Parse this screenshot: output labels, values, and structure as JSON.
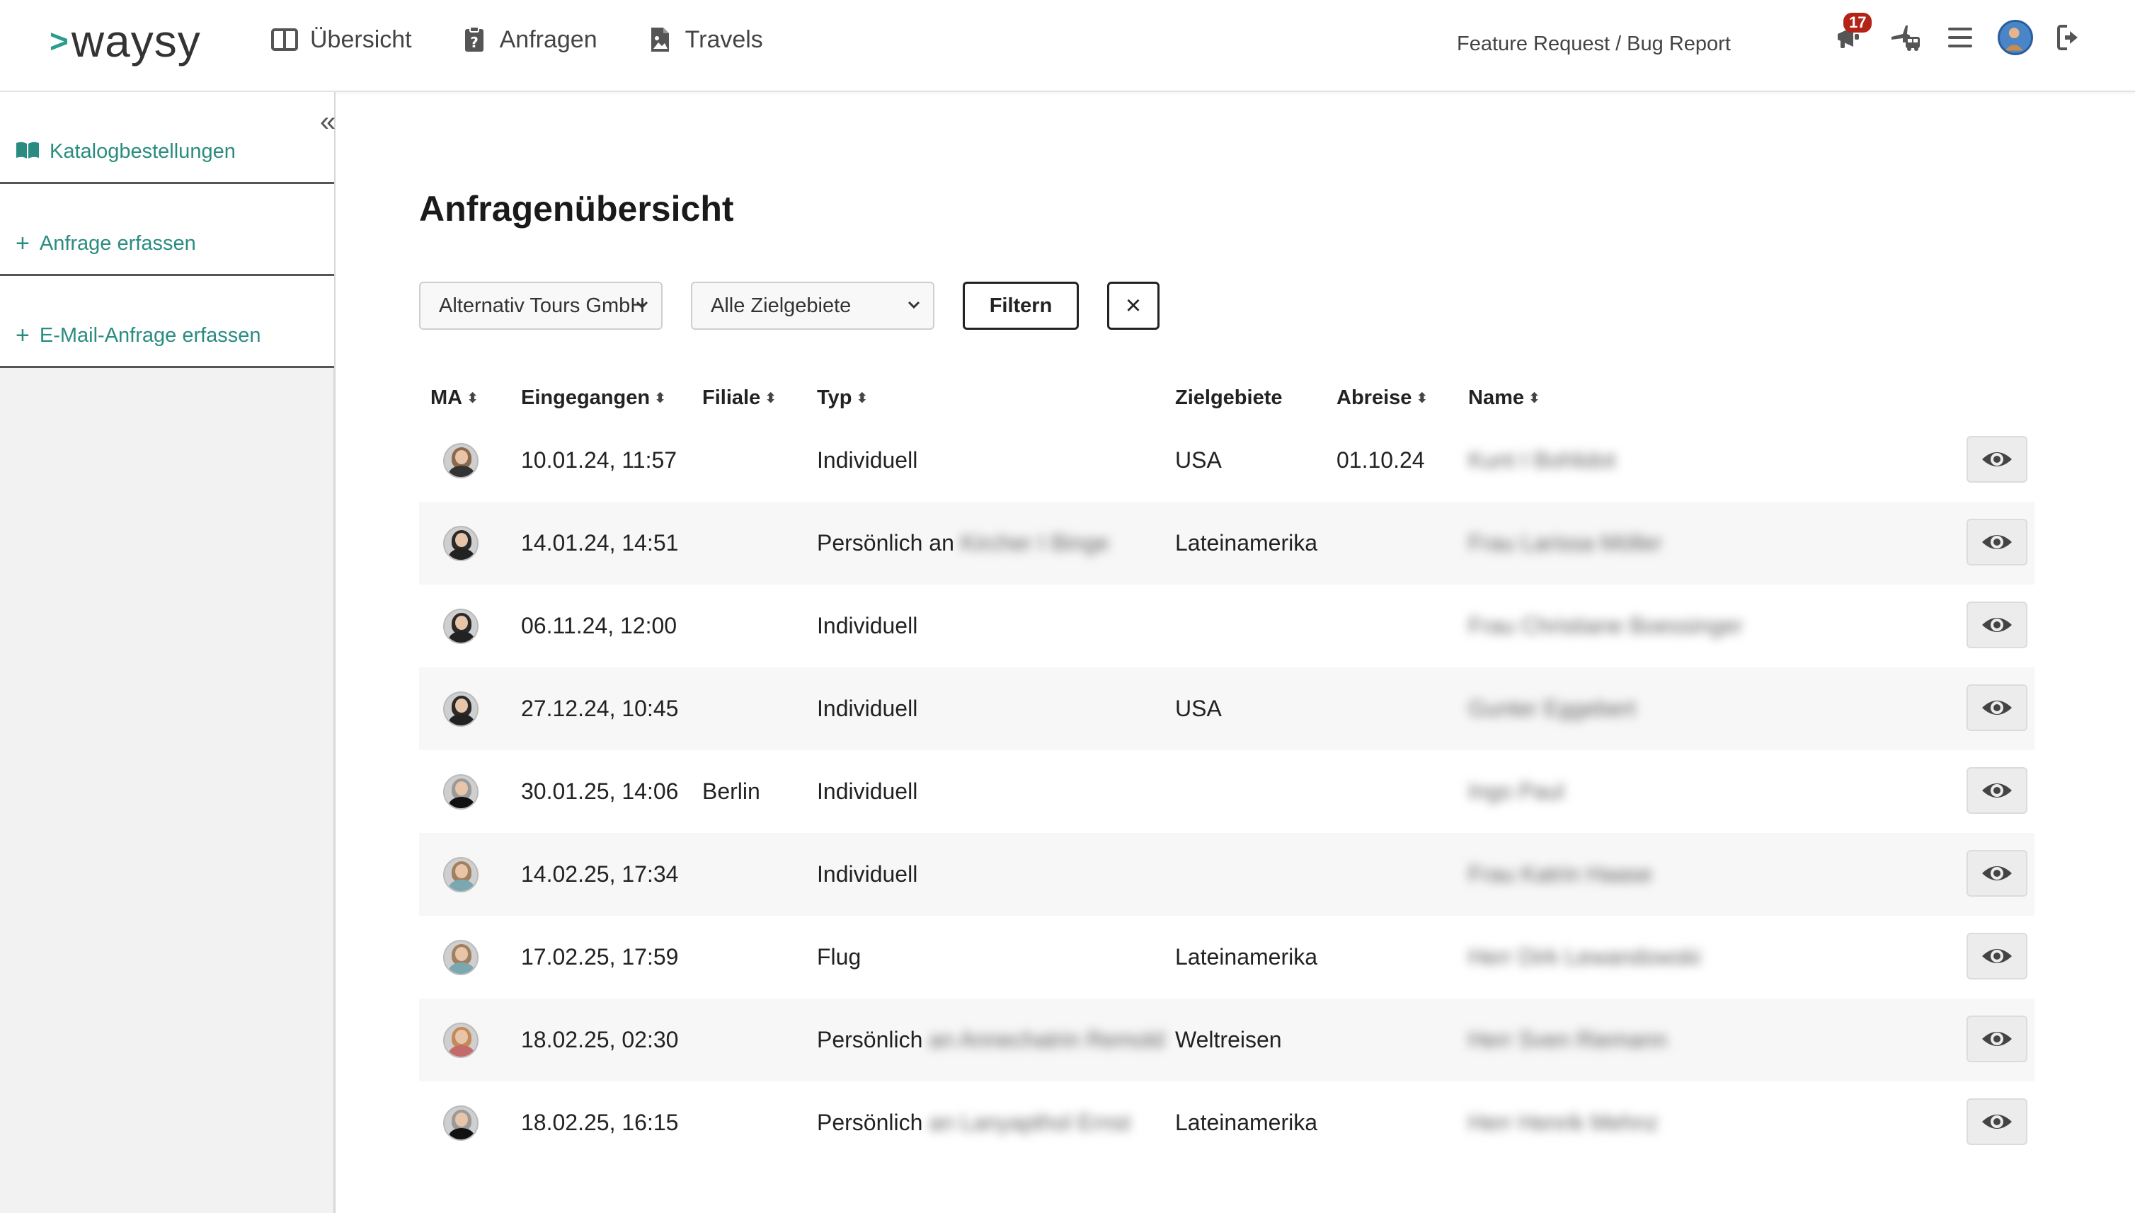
{
  "brand": {
    "name": "waysy",
    "arrow": ">"
  },
  "nav": {
    "links": [
      {
        "label": "Übersicht",
        "icon": "columns-icon"
      },
      {
        "label": "Anfragen",
        "icon": "clipboard-question-icon"
      },
      {
        "label": "Travels",
        "icon": "file-image-icon"
      }
    ],
    "feature_link": "Feature Request / Bug Report",
    "notifications_count": "17"
  },
  "sidebar": {
    "collapse": "«",
    "items": [
      {
        "label": "Katalogbestellungen",
        "icon": "book-open-icon"
      },
      {
        "label": "Anfrage erfassen",
        "icon": "plus-icon"
      },
      {
        "label": "E-Mail-Anfrage erfassen",
        "icon": "plus-icon"
      }
    ]
  },
  "page": {
    "title": "Anfragenübersicht"
  },
  "filters": {
    "company_select": "Alternativ Tours GmbH",
    "region_select": "Alle Zielgebiete",
    "filter_button": "Filtern",
    "clear_button": "×"
  },
  "table": {
    "columns": [
      "MA",
      "Eingegangen",
      "Filiale",
      "Typ",
      "Zielgebiete",
      "Abreise",
      "Name"
    ],
    "rows": [
      {
        "received": "10.01.24, 11:57",
        "branch": "",
        "type": "Individuell",
        "type_extra": "",
        "region": "USA",
        "departure": "01.10.24",
        "name": "Kunt I Bohlidot"
      },
      {
        "received": "14.01.24, 14:51",
        "branch": "",
        "type": "Persönlich an",
        "type_extra": "Kircher I Binge",
        "region": "Lateinamerika",
        "departure": "",
        "name": "Frau Larissa Möller"
      },
      {
        "received": "06.11.24, 12:00",
        "branch": "",
        "type": "Individuell",
        "type_extra": "",
        "region": "",
        "departure": "",
        "name": "Frau Christiane Boessinger"
      },
      {
        "received": "27.12.24, 10:45",
        "branch": "",
        "type": "Individuell",
        "type_extra": "",
        "region": "USA",
        "departure": "",
        "name": "Gunter Eggebert"
      },
      {
        "received": "30.01.25, 14:06",
        "branch": "Berlin",
        "type": "Individuell",
        "type_extra": "",
        "region": "",
        "departure": "",
        "name": "Ingo Paul"
      },
      {
        "received": "14.02.25, 17:34",
        "branch": "",
        "type": "Individuell",
        "type_extra": "",
        "region": "",
        "departure": "",
        "name": "Frau Katrin Haase"
      },
      {
        "received": "17.02.25, 17:59",
        "branch": "",
        "type": "Flug",
        "type_extra": "",
        "region": "Lateinamerika",
        "departure": "",
        "name": "Herr Dirk Lewandowski"
      },
      {
        "received": "18.02.25, 02:30",
        "branch": "",
        "type": "Persönlich",
        "type_extra": "an Annechatrin Remold",
        "region": "Weltreisen",
        "departure": "",
        "name": "Herr Sven Riemann"
      },
      {
        "received": "18.02.25, 16:15",
        "branch": "",
        "type": "Persönlich",
        "type_extra": "an Lanyapthol Ernst",
        "region": "Lateinamerika",
        "departure": "",
        "name": "Herr Henrik Mehnz"
      }
    ]
  },
  "colors": {
    "accent": "#2a9d8f",
    "badge": "#b42318",
    "sidebar_bg": "#f2f2f2",
    "row_alt": "#f7f7f7"
  }
}
